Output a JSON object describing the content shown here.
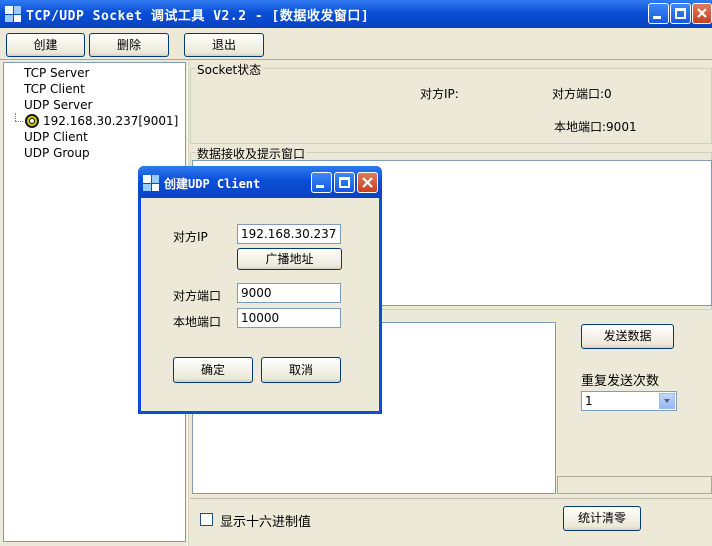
{
  "window": {
    "title": "TCP/UDP Socket 调试工具 V2.2 - [数据收发窗口]"
  },
  "toolbar": {
    "create_label": "创建",
    "delete_label": "删除",
    "exit_label": "退出"
  },
  "tree": {
    "items": [
      {
        "label": "TCP Server"
      },
      {
        "label": "TCP Client"
      },
      {
        "label": "UDP Server"
      },
      {
        "label": "192.168.30.237[9001]"
      },
      {
        "label": "UDP Client"
      },
      {
        "label": "UDP Group"
      }
    ]
  },
  "socket_status": {
    "group_label": "Socket状态",
    "peer_ip_label": "对方IP:",
    "peer_port_label": "对方端口:0",
    "local_port_label": "本地端口:9001"
  },
  "receive": {
    "group_label": "数据接收及提示窗口"
  },
  "send": {
    "send_button": "发送数据",
    "repeat_label": "重复发送次数",
    "repeat_value": "1",
    "hex_checkbox_label": "显示十六进制值",
    "hex_checked": false,
    "clear_stats_button": "统计清零"
  },
  "dialog": {
    "title": "创建UDP Client",
    "peer_ip_label": "对方IP",
    "peer_ip_value": "192.168.30.237",
    "broadcast_button": "广播地址",
    "peer_port_label": "对方端口",
    "peer_port_value": "9000",
    "local_port_label": "本地端口",
    "local_port_value": "10000",
    "ok_button": "确定",
    "cancel_button": "取消"
  },
  "colors": {
    "titlebar": "#0a4fd6",
    "face": "#ece9d8",
    "field_border": "#7f9db9"
  }
}
